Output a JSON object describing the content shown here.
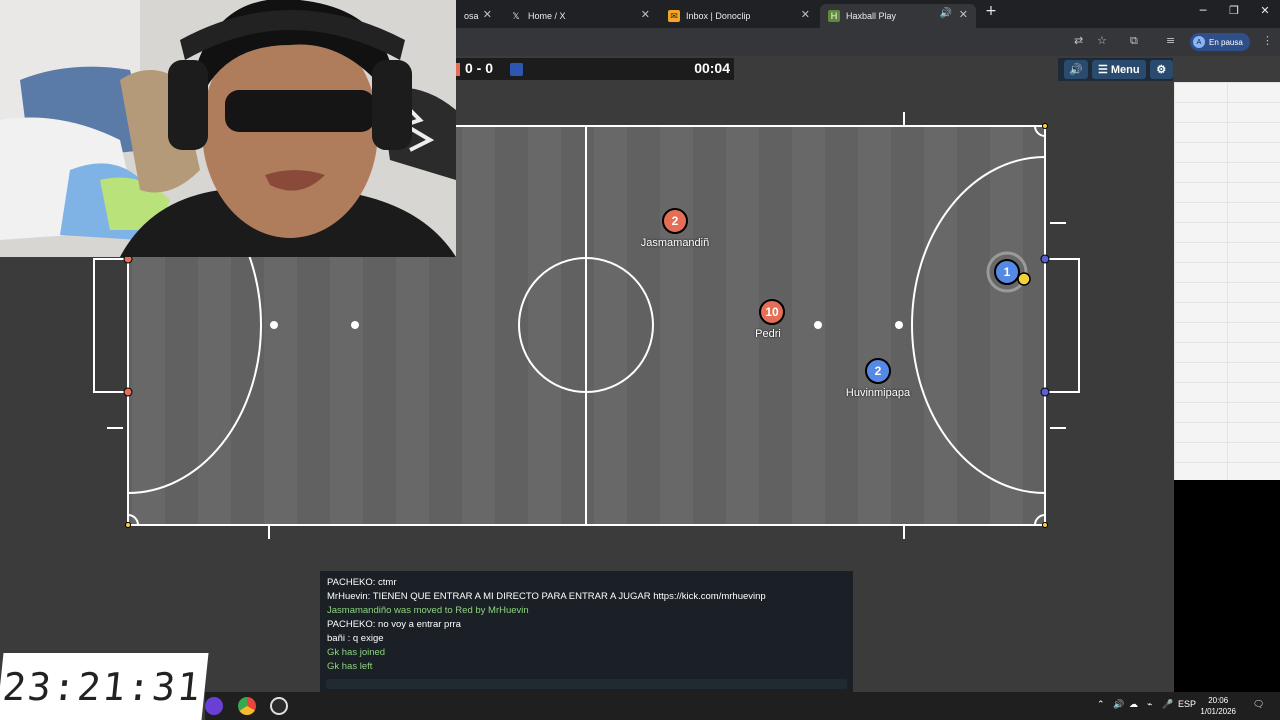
{
  "browser": {
    "tabs": [
      {
        "label": "osa",
        "icon": ""
      },
      {
        "label": "Home / X",
        "icon": "𝕏"
      },
      {
        "label": "Inbox | Donoclip",
        "icon": "✉"
      },
      {
        "label": "Haxball Play",
        "icon": "H"
      }
    ],
    "new_tab": "+",
    "profile_label": "En pausa",
    "profile_initial": "A"
  },
  "game": {
    "score": "0 - 0",
    "time": "00:04",
    "menu_label": "Menu",
    "players": [
      {
        "number": "2",
        "name": "Jasmamandiñ",
        "team": "red"
      },
      {
        "number": "10",
        "name": "Pedri",
        "team": "red"
      },
      {
        "number": "2",
        "name": "Huvinmipapa",
        "team": "blue"
      },
      {
        "number": "1",
        "name": "",
        "team": "blue"
      }
    ],
    "colors": {
      "red": "#e56e56",
      "blue": "#5689e5",
      "ball": "#f2d23c",
      "field": "#646464"
    }
  },
  "chat": {
    "messages": [
      {
        "text": "PACHEKO: ctmr",
        "system": false
      },
      {
        "text": "MrHuevin: TIENEN QUE ENTRAR A MI DIRECTO PARA ENTRAR A JUGAR https://kick.com/mrhuevinp",
        "system": false
      },
      {
        "text": "Jasmamandiño was moved to Red by MrHuevin",
        "system": true
      },
      {
        "text": "PACHEKO: no voy a entrar prra",
        "system": false
      },
      {
        "text": "bañi : q exige",
        "system": false
      },
      {
        "text": "Gk has joined",
        "system": true
      },
      {
        "text": "Gk has left",
        "system": true
      }
    ]
  },
  "overlay": {
    "clock": "23:21:31"
  },
  "taskbar": {
    "lang": "ESP",
    "time": "20:06",
    "date": "1/01/2026"
  }
}
